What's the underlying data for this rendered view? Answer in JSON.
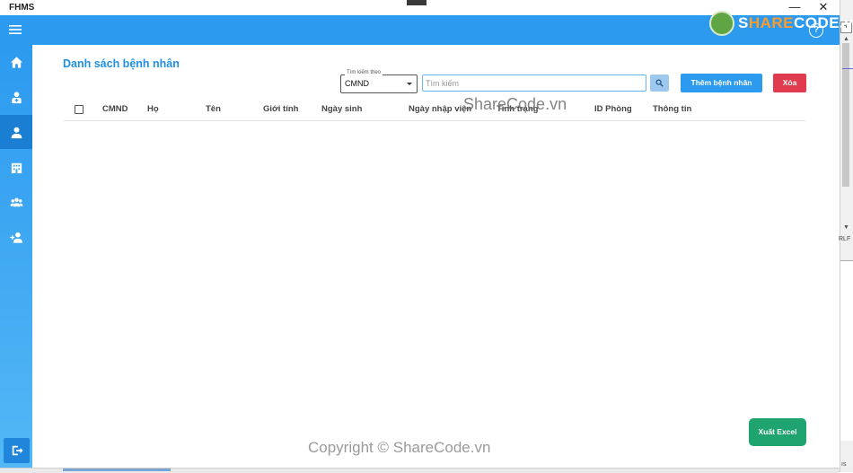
{
  "window": {
    "title": "FHMS",
    "minimize": "—",
    "close": "✕"
  },
  "header": {
    "menu_icon": "hamburger-icon",
    "help_icon": "help-icon",
    "help_glyph": "?"
  },
  "sidebar": {
    "items": [
      {
        "name": "home",
        "icon": "home-icon"
      },
      {
        "name": "doctor",
        "icon": "doctor-icon"
      },
      {
        "name": "patients",
        "icon": "user-icon",
        "active": true
      },
      {
        "name": "hospital",
        "icon": "building-icon"
      },
      {
        "name": "staff",
        "icon": "group-icon"
      },
      {
        "name": "add-user",
        "icon": "add-user-icon"
      }
    ],
    "logout_icon": "logout-icon"
  },
  "main": {
    "title": "Danh sách bệnh nhân",
    "search_by": {
      "label": "Tìm kiếm theo",
      "value": "CMND"
    },
    "search": {
      "placeholder": "Tìm kiếm"
    },
    "buttons": {
      "add": "Thêm bệnh nhân",
      "delete": "Xóa",
      "export": "Xuất Excel"
    },
    "table": {
      "columns": [
        "CMND",
        "Họ",
        "Tên",
        "Giới tính",
        "Ngày sinh",
        "Ngày nhập viện",
        "Tình trạng",
        "ID Phòng",
        "Thông tin"
      ],
      "rows": []
    }
  },
  "right_strip": {
    "plus": "+",
    "crlf": "RLF",
    "s": "ıs"
  },
  "watermarks": {
    "logo_prefix": "S",
    "logo_accent": "HARE",
    "logo_rest": "CODE.vn",
    "center": "ShareCode.vn",
    "bottom": "Copyright © ShareCode.vn"
  },
  "colors": {
    "primary": "#2c9aef",
    "danger": "#e03b4e",
    "success": "#1fa36f",
    "title": "#1e8fe4"
  }
}
